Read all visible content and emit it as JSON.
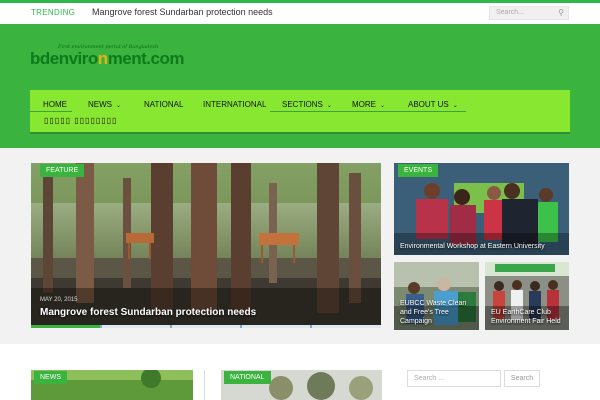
{
  "trending": {
    "label": "TRENDING",
    "headline": "Mangrove forest Sundarban protection needs",
    "search_placeholder": "Search..."
  },
  "logo": {
    "tagline": "First environment portal of Bangladesh",
    "part1": "bdenviro",
    "part2": "n",
    "part3": "ment.com"
  },
  "nav": {
    "items": [
      {
        "label": "HOME",
        "dropdown": false
      },
      {
        "label": "NEWS",
        "dropdown": true
      },
      {
        "label": "NATIONAL",
        "dropdown": false
      },
      {
        "label": "INTERNATIONAL",
        "dropdown": false
      },
      {
        "label": "SECTIONS",
        "dropdown": true
      },
      {
        "label": "MORE",
        "dropdown": true
      },
      {
        "label": "ABOUT US",
        "dropdown": true
      }
    ],
    "second_row": "▯▯▯▯▯ ▯▯▯▯▯▯▯▯"
  },
  "feature": {
    "tag": "FEATURE",
    "date": "MAY 20, 2015",
    "title": "Mangrove forest Sundarban protection needs"
  },
  "cards": [
    {
      "tag": "EVENTS",
      "caption": "Environmental Workshop at Eastern University"
    },
    {
      "tag": "",
      "caption": "EUBCC Waste Clean and Free's Tree Campaign"
    },
    {
      "tag": "",
      "caption": "EU EarthCare Club Environment Fair Held"
    }
  ],
  "lower": {
    "cards": [
      {
        "tag": "NEWS"
      },
      {
        "tag": "NATIONAL"
      }
    ],
    "search_placeholder": "Search ...",
    "search_button": "Search"
  },
  "colors": {
    "brand_green": "#3ab43e",
    "nav_green": "#88e831"
  }
}
